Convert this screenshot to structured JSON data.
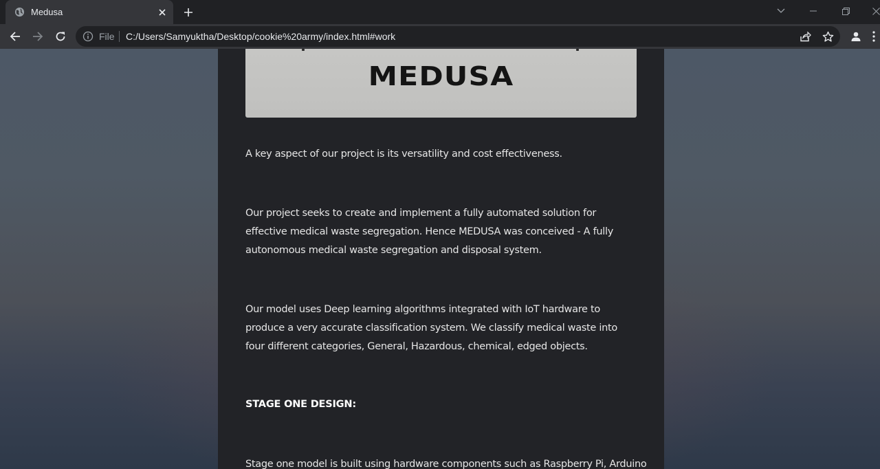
{
  "browser": {
    "tab": {
      "title": "Medusa",
      "favicon": "globe-icon"
    },
    "new_tab_icon": "plus-icon",
    "window_controls": [
      "chevron-down-icon",
      "minimize-icon",
      "restore-icon",
      "close-icon"
    ],
    "toolbar": {
      "back_icon": "arrow-left-icon",
      "forward_icon": "arrow-right-icon",
      "reload_icon": "reload-icon",
      "scheme_label": "File",
      "url": "C:/Users/Samyuktha/Desktop/cookie%20army/index.html#work",
      "share_icon": "share-icon",
      "bookmark_icon": "star-icon",
      "profile_icon": "profile-icon",
      "menu_icon": "kebab-menu-icon"
    }
  },
  "page": {
    "hero_title": "MEDUSA",
    "paragraphs": [
      "A key aspect of our project is its versatility and cost effectiveness.",
      "Our project seeks to create and implement a fully automated solution for effective medical waste segregation. Hence MEDUSA was conceived - A fully autonomous medical waste segregation and disposal system.",
      "Our model uses Deep learning algorithms integrated with IoT hardware to produce a very accurate classification system. We classify medical waste into four different categories, General, Hazardous, chemical, edged objects."
    ],
    "section_heading": "STAGE ONE DESIGN:",
    "section_paragraph": "Stage one model is built using hardware components such as Raspberry Pi, Arduino"
  },
  "colors": {
    "chrome_dark": "#202124",
    "chrome_tab": "#35363a",
    "content_panel": "#222327",
    "hero_bg": "#c4c4c2"
  }
}
